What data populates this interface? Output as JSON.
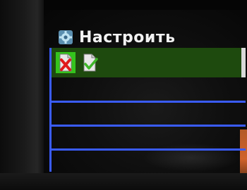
{
  "menu": {
    "title": "Настроить",
    "title_icon": "settings-gear-icon",
    "options": [
      {
        "name": "reject",
        "icon": "document-red-x-icon",
        "selected": true
      },
      {
        "name": "accept",
        "icon": "document-green-check-icon",
        "selected": false
      }
    ],
    "empty_rows": 4
  },
  "colors": {
    "row_border": "#3a5cff",
    "selected_row_bg": "#1e4a0e",
    "selected_option_bg": "#34c41c",
    "title_text": "#f2f2f2",
    "reject_mark": "#e01a1a",
    "accept_mark": "#3fb82a"
  }
}
